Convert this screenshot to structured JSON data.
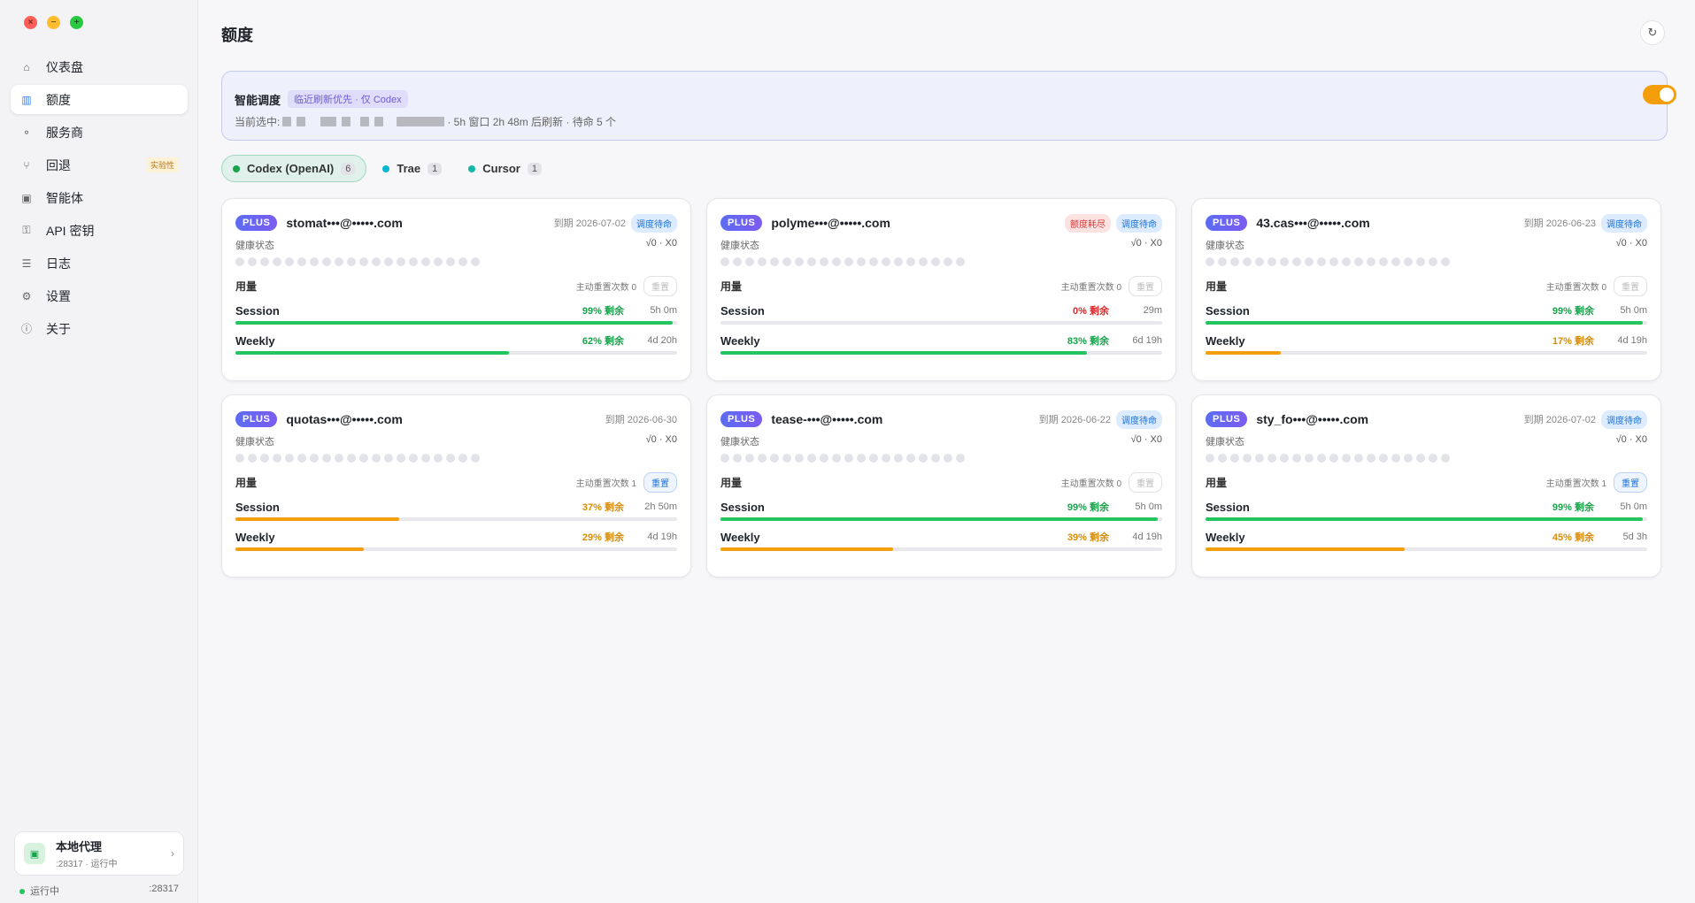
{
  "window": {
    "close_glyph": "×",
    "min_glyph": "−",
    "max_glyph": "+"
  },
  "sidebar": {
    "items": [
      {
        "icon": "home-icon",
        "glyph": "⌂",
        "label": "仪表盘"
      },
      {
        "icon": "quota-icon",
        "glyph": "▥",
        "label": "额度",
        "active": true
      },
      {
        "icon": "provider-icon",
        "glyph": "⚬",
        "label": "服务商"
      },
      {
        "icon": "fallback-icon",
        "glyph": "⑂",
        "label": "回退",
        "tag": "实验性"
      },
      {
        "icon": "agent-icon",
        "glyph": "▣",
        "label": "智能体"
      },
      {
        "icon": "key-icon",
        "glyph": "⚿",
        "label": "API 密钥"
      },
      {
        "icon": "log-icon",
        "glyph": "☰",
        "label": "日志"
      },
      {
        "icon": "gear-icon",
        "glyph": "⚙",
        "label": "设置"
      },
      {
        "icon": "info-icon",
        "glyph": "ⓘ",
        "label": "关于"
      }
    ],
    "proxy": {
      "title": "本地代理",
      "subtitle": ":28317 · 运行中",
      "icon_glyph": "▣",
      "chevron": "›"
    },
    "footer": {
      "status": "运行中",
      "port": ":28317"
    }
  },
  "page": {
    "title": "额度",
    "refresh_glyph": "↻"
  },
  "scheduler": {
    "title": "智能调度",
    "badge": "临近刷新优先 · 仅 Codex",
    "selected_prefix": "当前选中:",
    "selected_suffix": "· 5h 窗口 2h 48m 后刷新 · 待命 5 个",
    "enabled": true
  },
  "tabs": [
    {
      "label": "Codex (OpenAI)",
      "count": "6",
      "color": "#16a34a",
      "active": true
    },
    {
      "label": "Trae",
      "count": "1",
      "color": "#06b6d4"
    },
    {
      "label": "Cursor",
      "count": "1",
      "color": "#14b8a6"
    }
  ],
  "labels": {
    "health": "健康状态",
    "usage": "用量",
    "reset_count_prefix": "主动重置次数 ",
    "reset_button": "重置",
    "expire_prefix": "到期 "
  },
  "accounts": [
    {
      "plan": "PLUS",
      "email": "stomat•••@•••••.com",
      "expire": "2026-07-02",
      "badges": [
        "调度待命"
      ],
      "health": "√0 · X0",
      "reset_count": "0",
      "reset_enabled": false,
      "session": {
        "pct": "99% 剩余",
        "value": 99,
        "time": "5h 0m",
        "color": "green"
      },
      "weekly": {
        "pct": "62% 剩余",
        "value": 62,
        "time": "4d 20h",
        "color": "green"
      }
    },
    {
      "plan": "PLUS",
      "email": "polyme•••@•••••.com",
      "expire": "",
      "badges": [
        "额度耗尽",
        "调度待命"
      ],
      "health": "√0 · X0",
      "reset_count": "0",
      "reset_enabled": false,
      "session": {
        "pct": "0% 剩余",
        "value": 0,
        "time": "29m",
        "color": "red"
      },
      "weekly": {
        "pct": "83% 剩余",
        "value": 83,
        "time": "6d 19h",
        "color": "green"
      }
    },
    {
      "plan": "PLUS",
      "email": "43.cas•••@•••••.com",
      "expire": "2026-06-23",
      "badges": [
        "调度待命"
      ],
      "health": "√0 · X0",
      "reset_count": "0",
      "reset_enabled": false,
      "session": {
        "pct": "99% 剩余",
        "value": 99,
        "time": "5h 0m",
        "color": "green"
      },
      "weekly": {
        "pct": "17% 剩余",
        "value": 17,
        "time": "4d 19h",
        "color": "orange"
      }
    },
    {
      "plan": "PLUS",
      "email": "quotas•••@•••••.com",
      "expire": "2026-06-30",
      "badges": [],
      "health": "√0 · X0",
      "reset_count": "1",
      "reset_enabled": true,
      "session": {
        "pct": "37% 剩余",
        "value": 37,
        "time": "2h 50m",
        "color": "orange"
      },
      "weekly": {
        "pct": "29% 剩余",
        "value": 29,
        "time": "4d 19h",
        "color": "orange"
      }
    },
    {
      "plan": "PLUS",
      "email": "tease-•••@•••••.com",
      "expire": "2026-06-22",
      "badges": [
        "调度待命"
      ],
      "health": "√0 · X0",
      "reset_count": "0",
      "reset_enabled": false,
      "session": {
        "pct": "99% 剩余",
        "value": 99,
        "time": "5h 0m",
        "color": "green"
      },
      "weekly": {
        "pct": "39% 剩余",
        "value": 39,
        "time": "4d 19h",
        "color": "orange"
      }
    },
    {
      "plan": "PLUS",
      "email": "sty_fo•••@•••••.com",
      "expire": "2026-07-02",
      "badges": [
        "调度待命"
      ],
      "health": "√0 · X0",
      "reset_count": "1",
      "reset_enabled": true,
      "session": {
        "pct": "99% 剩余",
        "value": 99,
        "time": "5h 0m",
        "color": "green"
      },
      "weekly": {
        "pct": "45% 剩余",
        "value": 45,
        "time": "5d 3h",
        "color": "orange"
      }
    }
  ]
}
